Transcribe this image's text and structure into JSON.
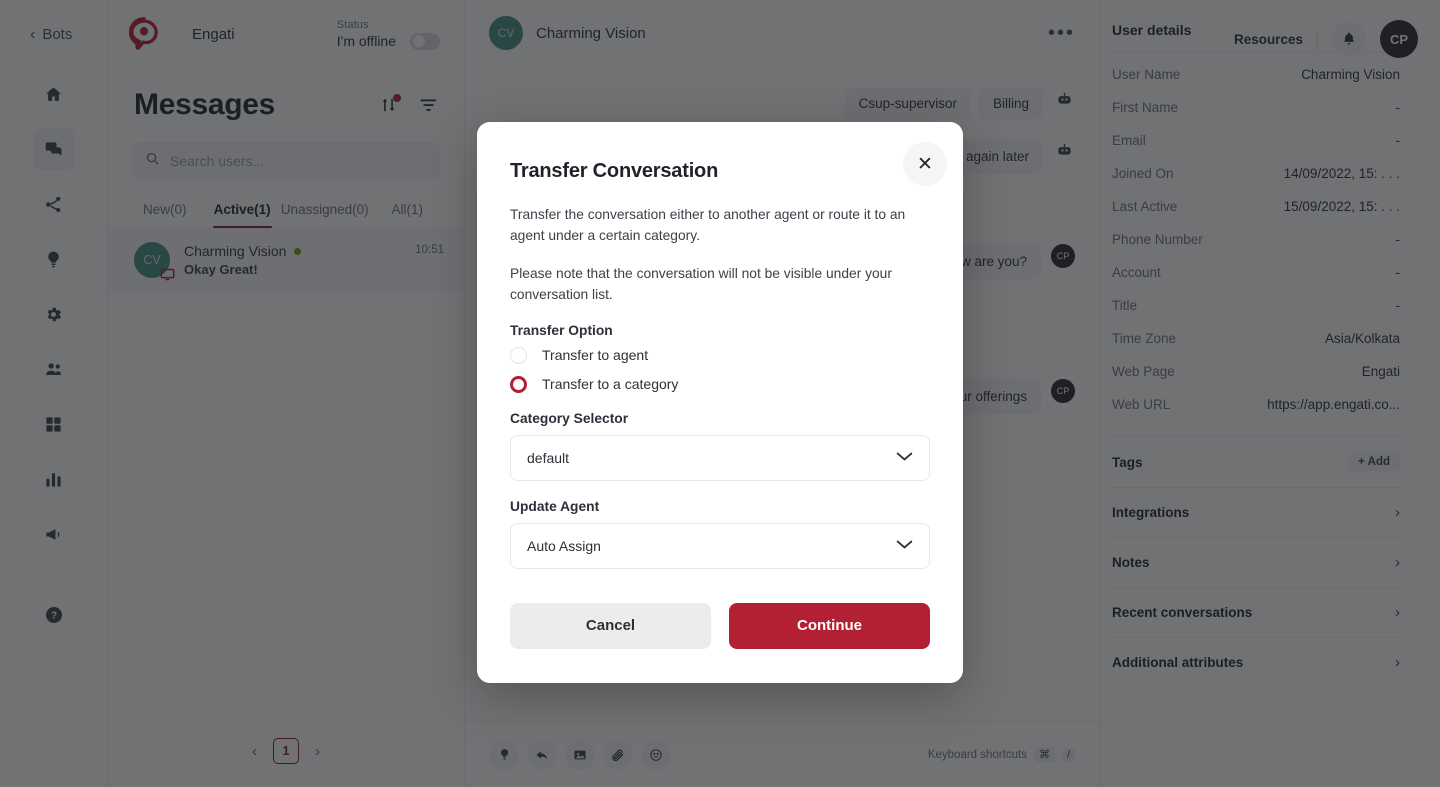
{
  "rail": {
    "back_label": "Bots",
    "items": [
      {
        "name": "home-icon",
        "label": "Home"
      },
      {
        "name": "chat-icon",
        "label": "Messages"
      },
      {
        "name": "flow-icon",
        "label": "Paths"
      },
      {
        "name": "bulb-icon",
        "label": "Intelligence"
      },
      {
        "name": "gear-icon",
        "label": "Configure"
      },
      {
        "name": "users-icon",
        "label": "Users"
      },
      {
        "name": "apps-icon",
        "label": "Integrations"
      },
      {
        "name": "chart-icon",
        "label": "Analytics"
      },
      {
        "name": "megaphone-icon",
        "label": "Broadcast"
      }
    ],
    "help_label": "Help"
  },
  "brand": {
    "name": "Engati",
    "status_label": "Status",
    "status_text": "I'm offline",
    "status_on": false
  },
  "messages_panel": {
    "title": "Messages",
    "sort_icon": "sort-icon",
    "filter_icon": "filter-icon",
    "search_placeholder": "Search users...",
    "tabs": [
      {
        "label": "New(0)",
        "active": false
      },
      {
        "label": "Active(1)",
        "active": true
      },
      {
        "label": "Unassigned(0)",
        "active": false
      },
      {
        "label": "All(1)",
        "active": false
      }
    ],
    "conversations": [
      {
        "initials": "CV",
        "name": "Charming Vision",
        "preview": "Okay Great!",
        "time": "10:51",
        "online": true
      }
    ],
    "pagination": {
      "prev": "‹",
      "page": "1",
      "next": "›"
    }
  },
  "chat": {
    "initials": "CV",
    "name": "Charming Vision",
    "more": "•••",
    "chips": [
      "Csup-supervisor",
      "Billing"
    ],
    "messages": [
      {
        "from": "bot",
        "text": "Please try again later"
      },
      {
        "from": "agent",
        "text": "Hi, how are you?",
        "avatar": "CP"
      },
      {
        "from": "agent",
        "text": "Here are our offerings",
        "avatar": "CP"
      }
    ],
    "composer_icons": [
      "bulb-icon",
      "reply-icon",
      "image-icon",
      "attachment-icon",
      "emoji-icon"
    ],
    "keyboard_hint": "Keyboard shortcuts",
    "keys": [
      "⌘",
      "/"
    ]
  },
  "header": {
    "resources_label": "Resources",
    "bell_icon": "bell-icon",
    "avatar_initials": "CP"
  },
  "details": {
    "title": "User details",
    "rows": [
      {
        "key": "User Name",
        "value": "Charming Vision"
      },
      {
        "key": "First Name",
        "value": "-"
      },
      {
        "key": "Email",
        "value": "-"
      },
      {
        "key": "Joined On",
        "value": "14/09/2022, 15: . . ."
      },
      {
        "key": "Last Active",
        "value": "15/09/2022, 15: . . ."
      },
      {
        "key": "Phone Number",
        "value": "-"
      },
      {
        "key": "Account",
        "value": "-"
      },
      {
        "key": "Title",
        "value": "-"
      },
      {
        "key": "Time Zone",
        "value": "Asia/Kolkata"
      },
      {
        "key": "Web Page",
        "value": "Engati"
      },
      {
        "key": "Web URL",
        "value": "https://app.engati.co..."
      }
    ],
    "tags_label": "Tags",
    "tags_add": "+ Add",
    "sections": [
      {
        "label": "Integrations"
      },
      {
        "label": "Notes"
      },
      {
        "label": "Recent conversations"
      },
      {
        "label": "Additional attributes"
      }
    ]
  },
  "modal": {
    "title": "Transfer Conversation",
    "close_icon": "close-icon",
    "paragraph_1": "Transfer the conversation either to another agent or route it to an agent under a certain category.",
    "paragraph_2": "Please note that the conversation will not be visible under your conversation list.",
    "transfer_option_label": "Transfer Option",
    "options": [
      {
        "label": "Transfer to agent",
        "selected": false
      },
      {
        "label": "Transfer to a category",
        "selected": true
      }
    ],
    "category_label": "Category Selector",
    "category_value": "default",
    "agent_label": "Update Agent",
    "agent_value": "Auto Assign",
    "cancel_label": "Cancel",
    "continue_label": "Continue"
  },
  "colors": {
    "brand_red": "#b32033",
    "accent_dark_red": "#8c1b2c",
    "avatar_teal": "#3f8f85",
    "online_green": "#65a30d"
  }
}
